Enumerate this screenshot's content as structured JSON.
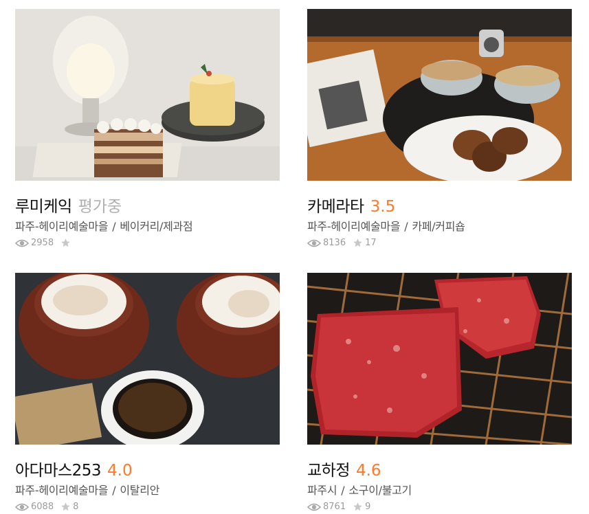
{
  "restaurants": [
    {
      "name": "루미케익",
      "score": "평가중",
      "location": "파주-헤이리예술마을",
      "category": "베이커리/제과점",
      "views": "2958",
      "reviews": ""
    },
    {
      "name": "카메라타",
      "score": "3.5",
      "location": "파주-헤이리예술마을",
      "category": "카페/커피숍",
      "views": "8136",
      "reviews": "17"
    },
    {
      "name": "아다마스253",
      "score": "4.0",
      "location": "파주-헤이리예술마을",
      "category": "이탈리안",
      "views": "6088",
      "reviews": "8"
    },
    {
      "name": "교하정",
      "score": "4.6",
      "location": "파주시",
      "category": "소구이/불고기",
      "views": "8761",
      "reviews": "9"
    }
  ],
  "separator": "/",
  "colors": {
    "score": "#ff792a",
    "pending": "#b0b0b0",
    "meta_text": "#555555",
    "stat_text": "#9b9b9b"
  },
  "icons": {
    "views": "eye-icon",
    "reviews": "star-icon"
  },
  "images": [
    "cake-on-plates-photo",
    "coffee-cups-and-cakes-photo",
    "cappuccino-cups-photo",
    "raw-beef-on-grill-photo"
  ]
}
